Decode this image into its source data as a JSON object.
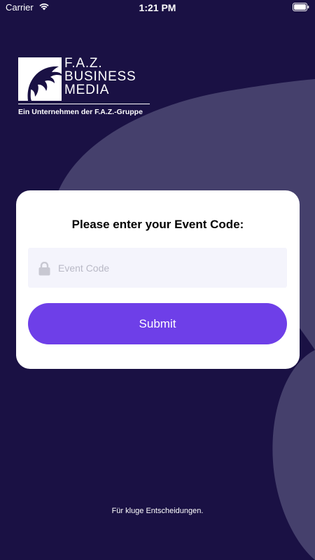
{
  "status_bar": {
    "carrier": "Carrier",
    "time": "1:21 PM"
  },
  "logo": {
    "brand_line1": "F.A.Z.",
    "brand_line2": "BUSINESS",
    "brand_line3": "MEDIA",
    "tagline": "Ein Unternehmen der F.A.Z.-Gruppe"
  },
  "event_form": {
    "prompt": "Please enter your Event Code:",
    "code_placeholder": "Event Code",
    "code_value": "",
    "submit_label": "Submit"
  },
  "footer": {
    "slogan": "Für kluge Entscheidungen."
  },
  "colors": {
    "background": "#1a1144",
    "background_shape": "#45406c",
    "button": "#6e3fe8",
    "input_background": "#f4f4fc"
  }
}
